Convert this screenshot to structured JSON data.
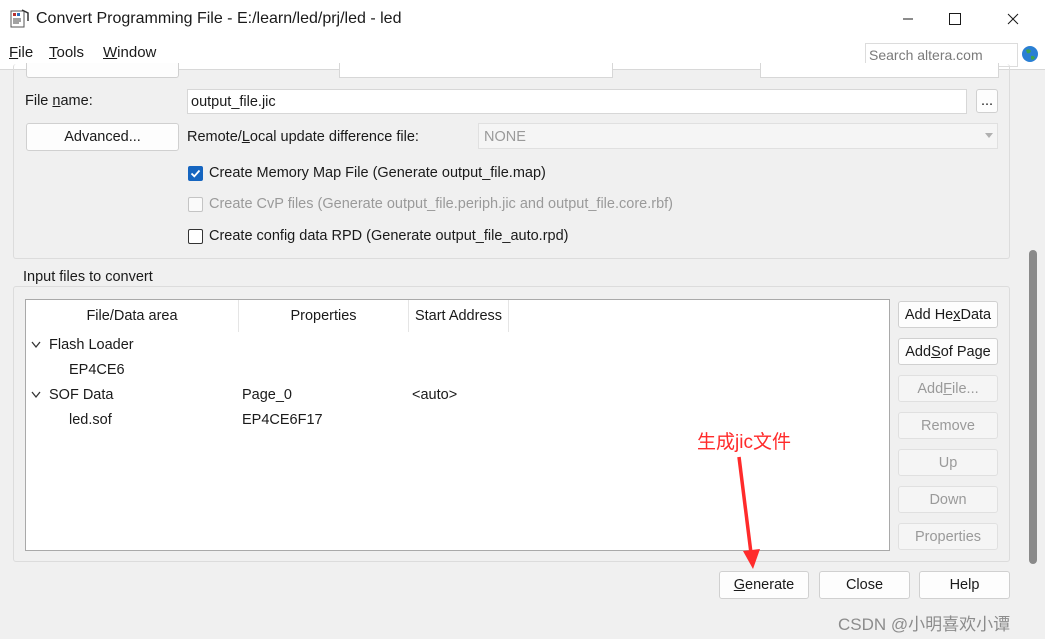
{
  "window": {
    "title": "Convert Programming File - E:/learn/led/prj/led - led",
    "controls": [
      "minimize-icon",
      "maximize-icon",
      "close-icon"
    ]
  },
  "menu": {
    "items": [
      {
        "label": "File",
        "mnemonic": "F",
        "rest": "ile"
      },
      {
        "label": "Tools",
        "mnemonic": "T",
        "rest": "ools"
      },
      {
        "label": "Window",
        "mnemonic": "W",
        "rest": "indow"
      }
    ],
    "search_placeholder": "Search altera.com"
  },
  "output": {
    "file_name_label_pre": "File ",
    "file_name_label_mn": "n",
    "file_name_label_post": "ame:",
    "file_name_value": "output_file.jic",
    "browse_label": "...",
    "advanced_label": "Advanced...",
    "remote_label_pre": "Remote/",
    "remote_label_mn": "L",
    "remote_label_post": "ocal update difference file:",
    "remote_value": "NONE",
    "checkboxes": [
      {
        "label": "Create Memory Map File (Generate output_file.map)",
        "checked": true,
        "enabled": true
      },
      {
        "label": "Create CvP files (Generate output_file.periph.jic and output_file.core.rbf)",
        "checked": false,
        "enabled": false
      },
      {
        "label": "Create config data RPD (Generate output_file_auto.rpd)",
        "checked": false,
        "enabled": true
      }
    ]
  },
  "input_files": {
    "group_title": "Input files to convert",
    "columns": [
      "File/Data area",
      "Properties",
      "Start Address"
    ],
    "rows": [
      {
        "name": "Flash Loader",
        "properties": "",
        "start": "",
        "level": 0,
        "expanded": true
      },
      {
        "name": "EP4CE6",
        "properties": "",
        "start": "",
        "level": 1
      },
      {
        "name": "SOF Data",
        "properties": "Page_0",
        "start": "<auto>",
        "level": 0,
        "expanded": true
      },
      {
        "name": "led.sof",
        "properties": "EP4CE6F17",
        "start": "",
        "level": 1
      }
    ],
    "side_buttons": [
      {
        "pre": "Add He",
        "mn": "x",
        "post": " Data",
        "enabled": true
      },
      {
        "pre": "Add ",
        "mn": "S",
        "post": "of Page",
        "enabled": true
      },
      {
        "pre": "Add ",
        "mn": "F",
        "post": "ile...",
        "enabled": false
      },
      {
        "pre": "Remove",
        "mn": "",
        "post": "",
        "enabled": false
      },
      {
        "pre": "Up",
        "mn": "",
        "post": "",
        "enabled": false
      },
      {
        "pre": "Down",
        "mn": "",
        "post": "",
        "enabled": false
      },
      {
        "pre": "Properties",
        "mn": "",
        "post": "",
        "enabled": false
      }
    ]
  },
  "footer": {
    "generate_mn": "G",
    "generate_rest": "enerate",
    "close_label": "Close",
    "help_label": "Help"
  },
  "annotation": {
    "text": "生成jic文件",
    "color": "#ff2b2b"
  },
  "watermark": "CSDN @小明喜欢小谭",
  "colors": {
    "accent": "#1565c0",
    "annotation": "#ff2b2b"
  }
}
